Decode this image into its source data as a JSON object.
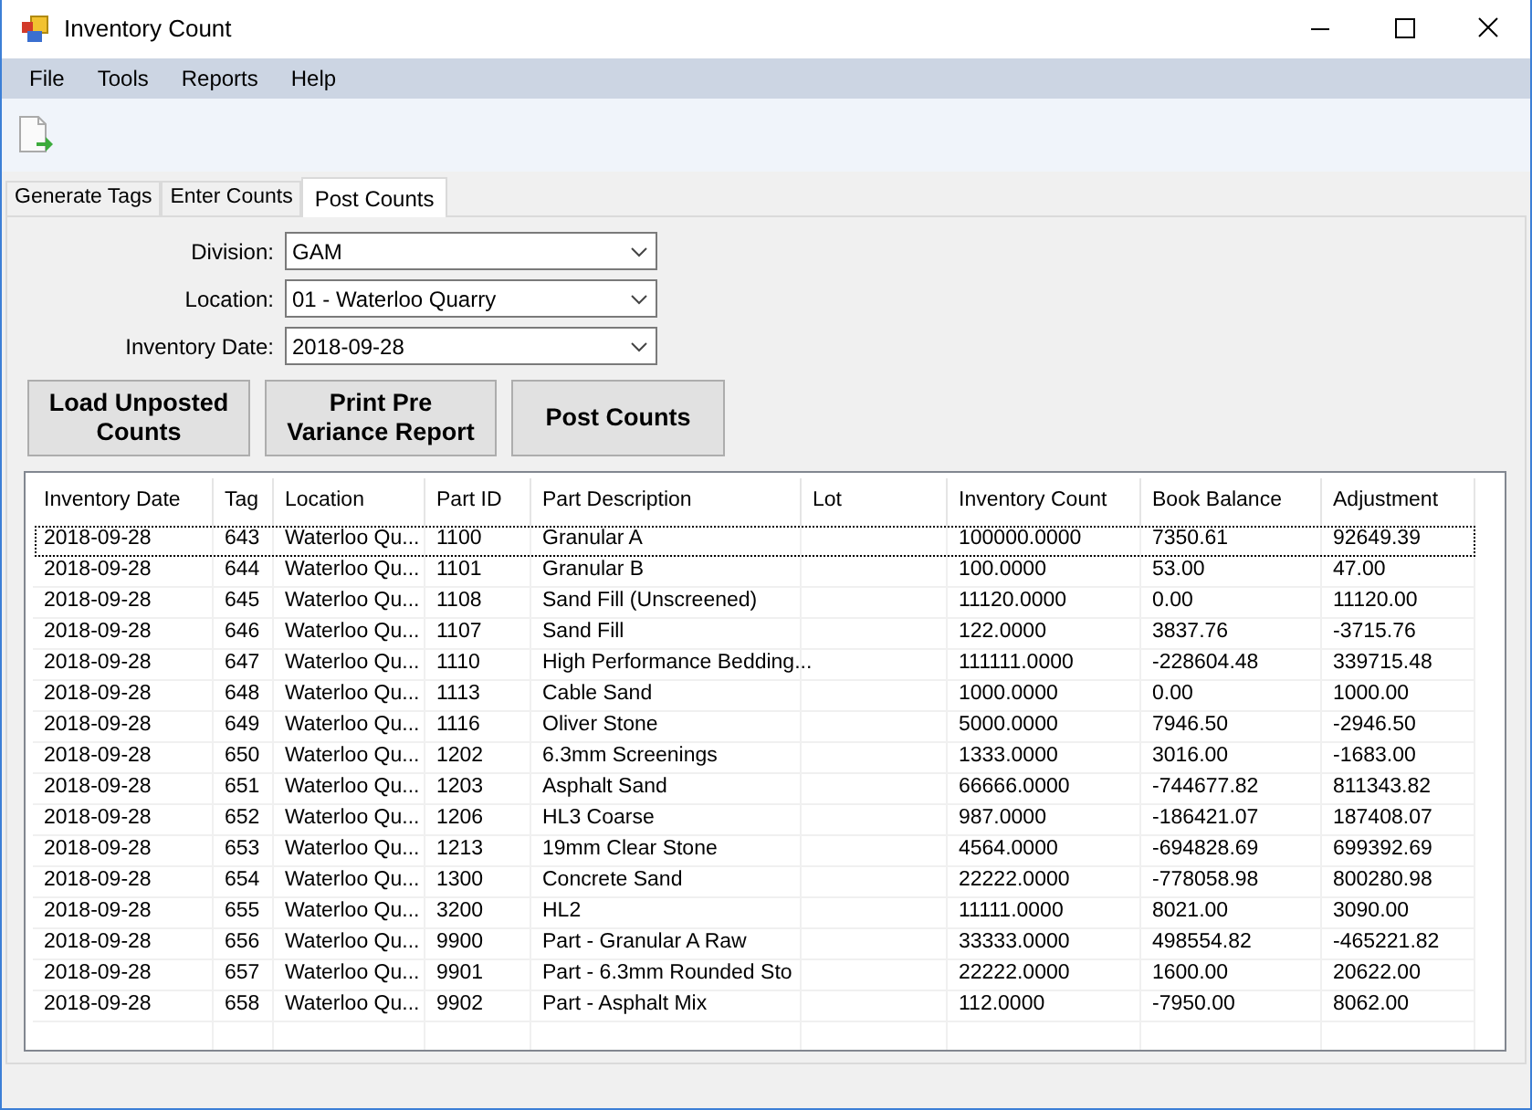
{
  "window": {
    "title": "Inventory Count"
  },
  "menu": [
    "File",
    "Tools",
    "Reports",
    "Help"
  ],
  "tabs": [
    {
      "label": "Generate Tags",
      "selected": false
    },
    {
      "label": "Enter Counts",
      "selected": false
    },
    {
      "label": "Post Counts",
      "selected": true
    }
  ],
  "form": [
    {
      "label": "Division:",
      "value": "GAM"
    },
    {
      "label": "Location:",
      "value": "01 - Waterloo Quarry"
    },
    {
      "label": "Inventory Date:",
      "value": "2018-09-28"
    }
  ],
  "buttons": [
    [
      "Load Unposted",
      "Counts"
    ],
    [
      "Print Pre",
      "Variance Report"
    ],
    [
      "Post Counts"
    ]
  ],
  "table": {
    "columns": [
      "Inventory Date",
      "Tag",
      "Location",
      "Part ID",
      "Part Description",
      "Lot",
      "Inventory Count",
      "Book Balance",
      "Adjustment"
    ],
    "rows": [
      {
        "focused": true,
        "cells": [
          "2018-09-28",
          "643",
          "Waterloo Qu...",
          "1100",
          "Granular A",
          "",
          "100000.0000",
          "7350.61",
          "92649.39"
        ]
      },
      {
        "focused": false,
        "cells": [
          "2018-09-28",
          "644",
          "Waterloo Qu...",
          "1101",
          "Granular B",
          "",
          "100.0000",
          "53.00",
          "47.00"
        ]
      },
      {
        "focused": false,
        "cells": [
          "2018-09-28",
          "645",
          "Waterloo Qu...",
          "1108",
          "Sand Fill (Unscreened)",
          "",
          "11120.0000",
          "0.00",
          "11120.00"
        ]
      },
      {
        "focused": false,
        "cells": [
          "2018-09-28",
          "646",
          "Waterloo Qu...",
          "1107",
          "Sand Fill",
          "",
          "122.0000",
          "3837.76",
          "-3715.76"
        ]
      },
      {
        "focused": false,
        "cells": [
          "2018-09-28",
          "647",
          "Waterloo Qu...",
          "1110",
          "High Performance Bedding...",
          "",
          "111111.0000",
          "-228604.48",
          "339715.48"
        ]
      },
      {
        "focused": false,
        "cells": [
          "2018-09-28",
          "648",
          "Waterloo Qu...",
          "1113",
          "Cable Sand",
          "",
          "1000.0000",
          "0.00",
          "1000.00"
        ]
      },
      {
        "focused": false,
        "cells": [
          "2018-09-28",
          "649",
          "Waterloo Qu...",
          "1116",
          "Oliver Stone",
          "",
          "5000.0000",
          "7946.50",
          "-2946.50"
        ]
      },
      {
        "focused": false,
        "cells": [
          "2018-09-28",
          "650",
          "Waterloo Qu...",
          "1202",
          "6.3mm Screenings",
          "",
          "1333.0000",
          "3016.00",
          "-1683.00"
        ]
      },
      {
        "focused": false,
        "cells": [
          "2018-09-28",
          "651",
          "Waterloo Qu...",
          "1203",
          "Asphalt Sand",
          "",
          "66666.0000",
          "-744677.82",
          "811343.82"
        ]
      },
      {
        "focused": false,
        "cells": [
          "2018-09-28",
          "652",
          "Waterloo Qu...",
          "1206",
          "HL3 Coarse",
          "",
          "987.0000",
          "-186421.07",
          "187408.07"
        ]
      },
      {
        "focused": false,
        "cells": [
          "2018-09-28",
          "653",
          "Waterloo Qu...",
          "1213",
          "19mm Clear Stone",
          "",
          "4564.0000",
          "-694828.69",
          "699392.69"
        ]
      },
      {
        "focused": false,
        "cells": [
          "2018-09-28",
          "654",
          "Waterloo Qu...",
          "1300",
          "Concrete Sand",
          "",
          "22222.0000",
          "-778058.98",
          "800280.98"
        ]
      },
      {
        "focused": false,
        "cells": [
          "2018-09-28",
          "655",
          "Waterloo Qu...",
          "3200",
          "HL2",
          "",
          "11111.0000",
          "8021.00",
          "3090.00"
        ]
      },
      {
        "focused": false,
        "cells": [
          "2018-09-28",
          "656",
          "Waterloo Qu...",
          "9900",
          "Part - Granular A Raw",
          "",
          "33333.0000",
          "498554.82",
          "-465221.82"
        ]
      },
      {
        "focused": false,
        "cells": [
          "2018-09-28",
          "657",
          "Waterloo Qu...",
          "9901",
          "Part - 6.3mm Rounded Sto",
          "",
          "22222.0000",
          "1600.00",
          "20622.00"
        ]
      },
      {
        "focused": false,
        "cells": [
          "2018-09-28",
          "658",
          "Waterloo Qu...",
          "9902",
          "Part - Asphalt Mix",
          "",
          "112.0000",
          "-7950.00",
          "8062.00"
        ]
      }
    ]
  }
}
